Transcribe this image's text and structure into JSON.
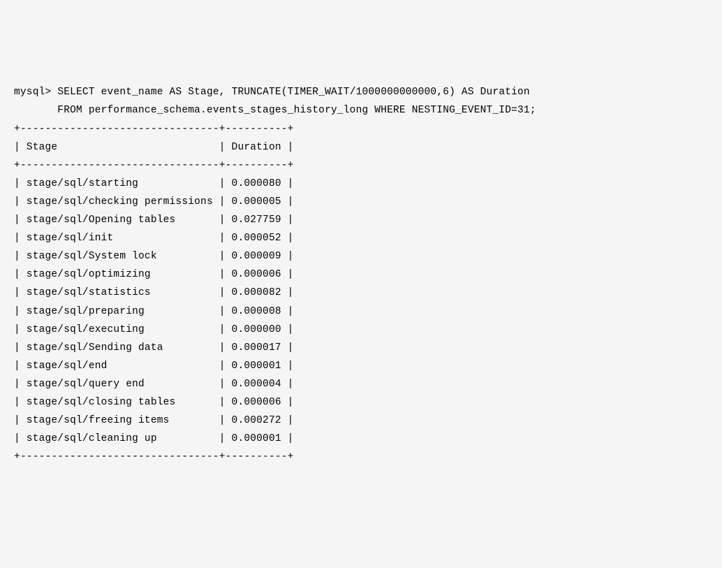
{
  "prompt": "mysql>",
  "query_line1": "SELECT event_name AS Stage, TRUNCATE(TIMER_WAIT/1000000000000,6) AS Duration",
  "query_line2": "       FROM performance_schema.events_stages_history_long WHERE NESTING_EVENT_ID=31;",
  "table_border": "+--------------------------------+----------+",
  "header_row": "| Stage                          | Duration |",
  "rows": [
    {
      "stage": "stage/sql/starting",
      "duration": "0.000080"
    },
    {
      "stage": "stage/sql/checking permissions",
      "duration": "0.000005"
    },
    {
      "stage": "stage/sql/Opening tables",
      "duration": "0.027759"
    },
    {
      "stage": "stage/sql/init",
      "duration": "0.000052"
    },
    {
      "stage": "stage/sql/System lock",
      "duration": "0.000009"
    },
    {
      "stage": "stage/sql/optimizing",
      "duration": "0.000006"
    },
    {
      "stage": "stage/sql/statistics",
      "duration": "0.000082"
    },
    {
      "stage": "stage/sql/preparing",
      "duration": "0.000008"
    },
    {
      "stage": "stage/sql/executing",
      "duration": "0.000000"
    },
    {
      "stage": "stage/sql/Sending data",
      "duration": "0.000017"
    },
    {
      "stage": "stage/sql/end",
      "duration": "0.000001"
    },
    {
      "stage": "stage/sql/query end",
      "duration": "0.000004"
    },
    {
      "stage": "stage/sql/closing tables",
      "duration": "0.000006"
    },
    {
      "stage": "stage/sql/freeing items",
      "duration": "0.000272"
    },
    {
      "stage": "stage/sql/cleaning up",
      "duration": "0.000001"
    }
  ]
}
